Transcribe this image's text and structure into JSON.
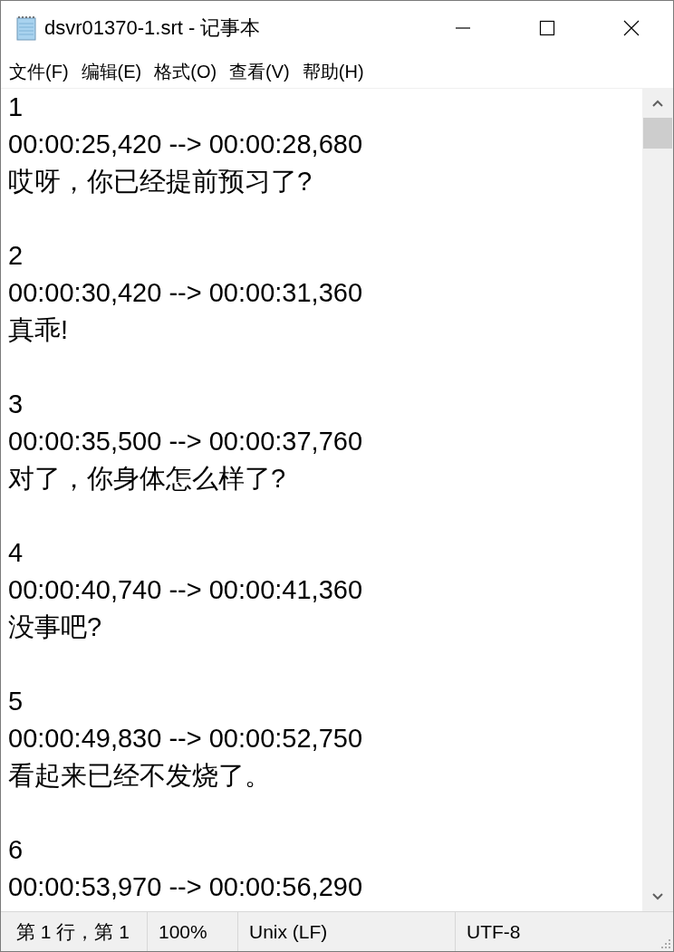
{
  "window": {
    "title": "dsvr01370-1.srt - 记事本"
  },
  "menu": [
    {
      "label": "文件(F)"
    },
    {
      "label": "编辑(E)"
    },
    {
      "label": "格式(O)"
    },
    {
      "label": "查看(V)"
    },
    {
      "label": "帮助(H)"
    }
  ],
  "editor": {
    "entries": [
      {
        "index": "1",
        "timing": "00:00:25,420 --> 00:00:28,680",
        "text": "哎呀，你已经提前预习了?"
      },
      {
        "index": "2",
        "timing": "00:00:30,420 --> 00:00:31,360",
        "text": "真乖!"
      },
      {
        "index": "3",
        "timing": "00:00:35,500 --> 00:00:37,760",
        "text": "对了，你身体怎么样了?"
      },
      {
        "index": "4",
        "timing": "00:00:40,740 --> 00:00:41,360",
        "text": "没事吧?"
      },
      {
        "index": "5",
        "timing": "00:00:49,830 --> 00:00:52,750",
        "text": "看起来已经不发烧了。"
      },
      {
        "index": "6",
        "timing": "00:00:53,970 --> 00:00:56,290"
      }
    ]
  },
  "status_bar": {
    "position": "第 1 行，第 1",
    "zoom": "100%",
    "line_ending": "Unix (LF)",
    "encoding": "UTF-8"
  }
}
